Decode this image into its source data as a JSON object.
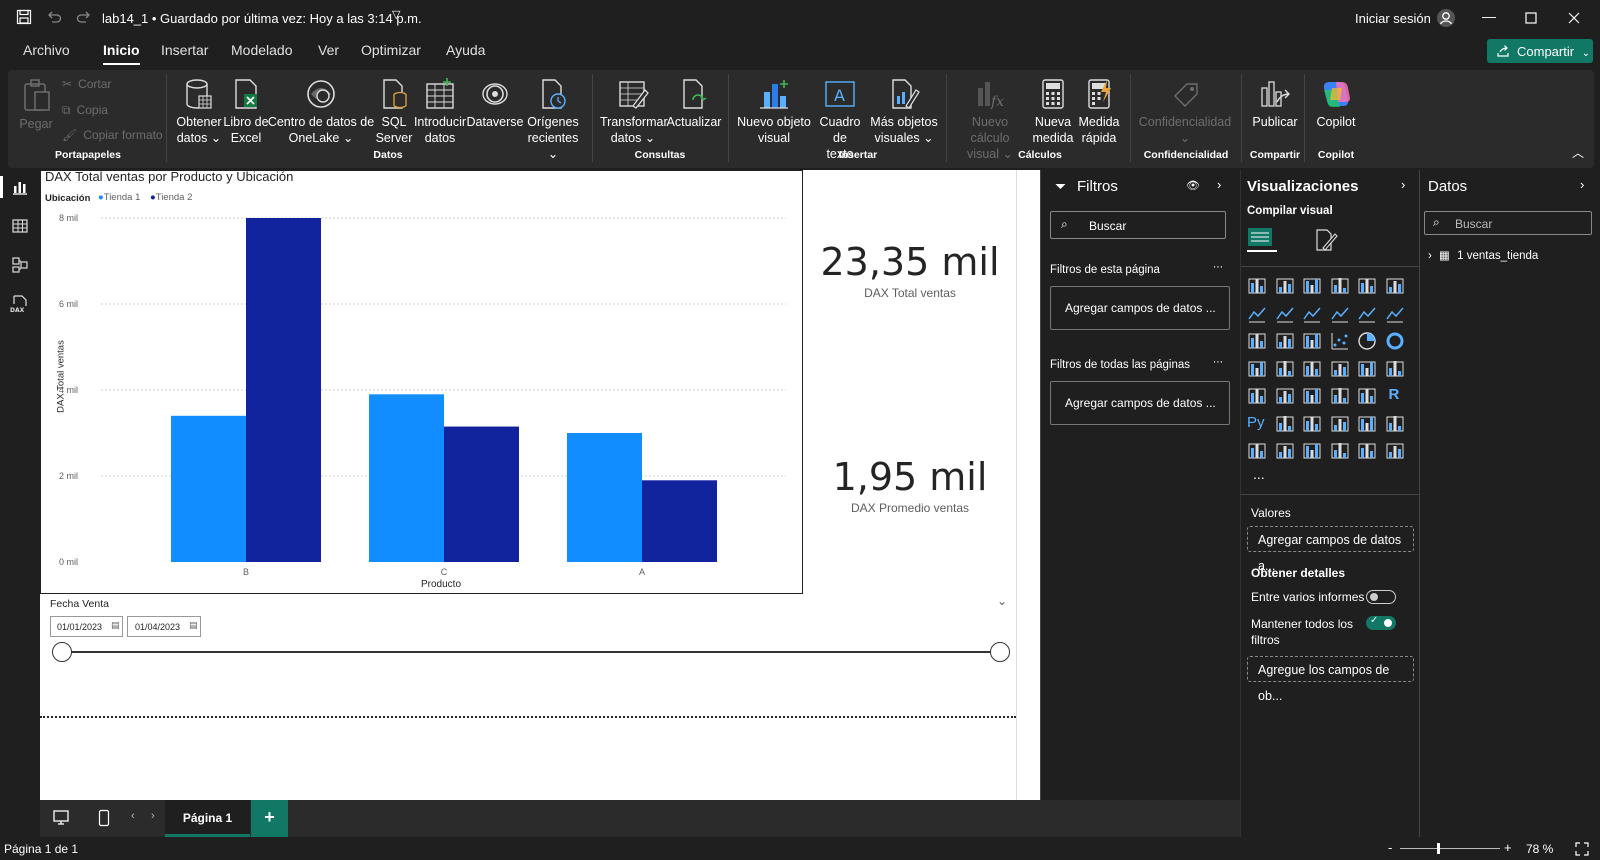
{
  "titlebar": {
    "doc_title": "lab14_1 • Guardado por última vez: Hoy a las 3:14 p.m.",
    "signin": "Iniciar sesión"
  },
  "menu": {
    "items": [
      "Archivo",
      "Inicio",
      "Insertar",
      "Modelado",
      "Ver",
      "Optimizar",
      "Ayuda"
    ],
    "share": "Compartir"
  },
  "ribbon": {
    "paste": "Pegar",
    "cut": "Cortar",
    "copy": "Copia",
    "format_painter": "Copiar formato",
    "group_clipboard": "Portapapeles",
    "get_data": [
      "Obtener",
      "datos ⌄"
    ],
    "excel": [
      "Libro de",
      "Excel"
    ],
    "onelake": [
      "Centro de datos de",
      "OneLake ⌄"
    ],
    "sql": [
      "SQL",
      "Server"
    ],
    "enter_data": [
      "Introducir",
      "datos"
    ],
    "dataverse": "Dataverse",
    "recent": [
      "Orígenes",
      "recientes ⌄"
    ],
    "group_data": "Datos",
    "transform": [
      "Transformar",
      "datos ⌄"
    ],
    "refresh": "Actualizar",
    "group_queries": "Consultas",
    "new_visual": [
      "Nuevo objeto",
      "visual"
    ],
    "textbox": [
      "Cuadro de",
      "texto"
    ],
    "more_visuals": [
      "Más objetos",
      "visuales ⌄"
    ],
    "group_insert": "Insertar",
    "new_calc": [
      "Nuevo cálculo",
      "visual ⌄"
    ],
    "new_measure": [
      "Nueva",
      "medida"
    ],
    "quick_measure": [
      "Medida",
      "rápida"
    ],
    "group_calcs": "Cálculos",
    "sensitivity": [
      "Confidencialidad",
      "⌄"
    ],
    "group_sensitivity": "Confidencialidad",
    "publish": "Publicar",
    "group_share": "Compartir",
    "copilot": "Copilot",
    "group_copilot": "Copilot"
  },
  "chart": {
    "title": "DAX Total ventas por Producto y Ubicación",
    "legend_title": "Ubicación",
    "colors": {
      "tienda1": "#118dff",
      "tienda2": "#12239e"
    }
  },
  "chart_data": {
    "type": "bar",
    "title": "DAX Total ventas por Producto y Ubicación",
    "xlabel": "Producto",
    "ylabel": "DAX Total ventas",
    "categories": [
      "B",
      "C",
      "A"
    ],
    "series": [
      {
        "name": "Tienda 1",
        "values": [
          3400,
          3900,
          3000
        ]
      },
      {
        "name": "Tienda 2",
        "values": [
          8000,
          3150,
          1900
        ]
      }
    ],
    "yticks": [
      "0 mil",
      "2 mil",
      "4 mil",
      "6 mil",
      "8 mil"
    ],
    "ylim": [
      0,
      8000
    ],
    "grid": true,
    "legend_position": "top-left"
  },
  "cards": [
    {
      "value": "23,35 mil",
      "label": "DAX Total ventas"
    },
    {
      "value": "1,95 mil",
      "label": "DAX Promedio ventas"
    }
  ],
  "slicer": {
    "title": "Fecha Venta",
    "start": "01/01/2023",
    "end": "01/04/2023"
  },
  "filters": {
    "title": "Filtros",
    "search_placeholder": "Buscar",
    "page_filters": "Filtros de esta página",
    "all_filters": "Filtros de todas las páginas",
    "add_fields": "Agregar campos de datos ..."
  },
  "viz": {
    "title": "Visualizaciones",
    "build": "Compilar visual",
    "values": "Valores",
    "add_values": "Agregar campos de datos a...",
    "drillthrough": "Obtener detalles",
    "cross_report": "Entre varios informes",
    "keep_filters": "Mantener todos los filtros",
    "add_drill": "Agregue los campos de ob...",
    "more": "...",
    "py": "Py",
    "r": "R"
  },
  "datos": {
    "title": "Datos",
    "search_placeholder": "Buscar",
    "table": "1 ventas_tienda"
  },
  "pages": {
    "page1": "Página 1",
    "add": "+"
  },
  "status": {
    "page": "Página 1 de 1",
    "zoom": "78 %",
    "minus": "-",
    "plus": "+"
  }
}
